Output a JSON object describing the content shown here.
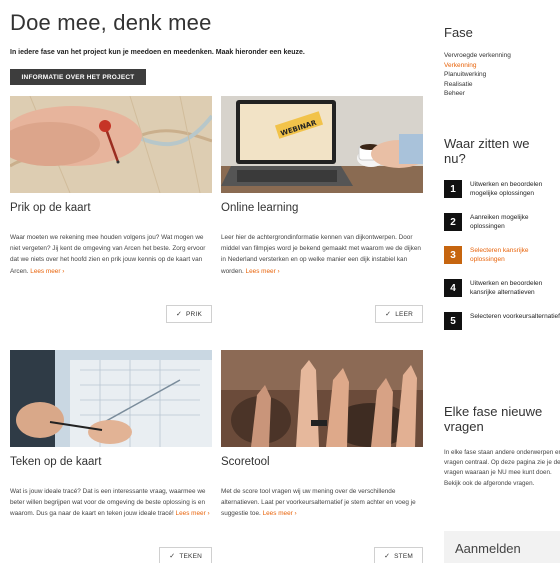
{
  "main": {
    "title": "Doe mee, denk mee",
    "intro": "In iedere fase van het project kun je meedoen en meedenken. Maak hieronder een keuze.",
    "info_button": "INFORMATIE OVER HET PROJECT"
  },
  "cards": [
    {
      "title": "Prik op de kaart",
      "desc": "Waar moeten we rekening mee houden volgens jou? Wat mogen we niet vergeten? Jij kent de omgeving van Arcen het beste. Zorg ervoor dat we niets over het hoofd zien en prik jouw kennis op de kaart van Arcen.",
      "more": "Lees meer ›",
      "action": "PRIK"
    },
    {
      "title": "Online learning",
      "desc": "Leer hier de achtergrondinformatie kennen van dijkontwerpen. Door middel van filmpjes word je bekend gemaakt met waarom we de dijken in Nederland versterken en op welke manier een dijk instabiel kan worden.",
      "more": "Lees meer ›",
      "action": "LEER",
      "image_text": "WEBINAR"
    },
    {
      "title": "Teken op de kaart",
      "desc": "Wat is jouw ideale tracé? Dat is een interessante vraag, waarmee we beter willen begrijpen wat voor de omgeving de beste oplossing is en waarom. Dus ga naar de kaart en teken jouw ideale tracé!",
      "more": "Lees meer ›",
      "action": "TEKEN"
    },
    {
      "title": "Scoretool",
      "desc": "Met de score tool vragen wij uw mening over de verschillende alternatieven. Laat per voorkeursalternatief je stem achter en voeg je suggestie toe.",
      "more": "Lees meer ›",
      "action": "STEM"
    }
  ],
  "check_glyph": "✓",
  "sidebar": {
    "fase_title": "Fase",
    "fases": [
      "Vervroegde verkenning",
      "Verkenning",
      "Planuitwerking",
      "Realisatie",
      "Beheer"
    ],
    "active_fase": 1,
    "waar_title": "Waar zitten we nu?",
    "steps": [
      {
        "num": "1",
        "label": "Uitwerken en beoordelen mogelijke oplossingen"
      },
      {
        "num": "2",
        "label": "Aanreiken mogelijke oplossingen"
      },
      {
        "num": "3",
        "label": "Selecteren kansrijke oplossingen"
      },
      {
        "num": "4",
        "label": "Uitwerken en beoordelen kansrijke alternatieven"
      },
      {
        "num": "5",
        "label": "Selecteren voorkeursalternatief"
      }
    ],
    "active_step": 2,
    "elke_title": "Elke fase nieuwe vragen",
    "elke_text": "In elke fase staan andere onderwerpen en vragen centraal. Op deze pagina zie je de vragen waaraan je NU mee kunt doen. Bekijk ook de afgeronde vragen.",
    "login_label": "Aanmelden"
  },
  "colors": {
    "accent": "#e8630a",
    "step_active": "#c6650f",
    "button_dark": "#3d3d3d"
  }
}
